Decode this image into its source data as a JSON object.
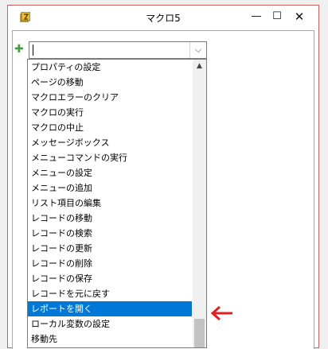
{
  "window": {
    "title": "マクロ5",
    "minimize_glyph": "—",
    "maximize_glyph": "☐",
    "close_glyph": "✕"
  },
  "editor": {
    "add_glyph": "✚",
    "combo_value": "",
    "dropdown_glyph": "⌵"
  },
  "dropdown": {
    "items": [
      "プロパティの設定",
      "ページの移動",
      "マクロエラーのクリア",
      "マクロの実行",
      "マクロの中止",
      "メッセージボックス",
      "メニューコマンドの実行",
      "メニューの設定",
      "メニューの追加",
      "リスト項目の編集",
      "レコードの移動",
      "レコードの検索",
      "レコードの更新",
      "レコードの削除",
      "レコードの保存",
      "レコードを元に戻す",
      "レポートを開く",
      "ローカル変数の設定",
      "移動先"
    ],
    "selected_index": 16,
    "scroll_up_glyph": "▲"
  },
  "annotation": {
    "color": "#e02020"
  },
  "colors": {
    "selection": "#0078d7",
    "window_border": "#c86060"
  }
}
